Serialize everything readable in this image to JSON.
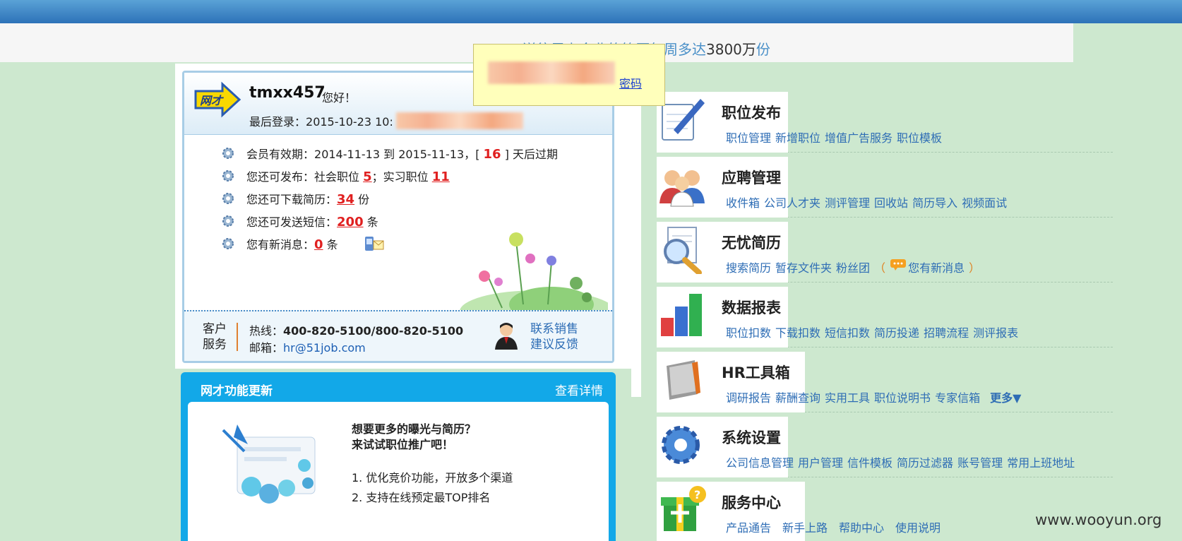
{
  "banner": {
    "text": "送往里上企业的简历每周多达",
    "number": "3800万",
    "unit": "份"
  },
  "tooltip": {
    "link": "密码"
  },
  "account": {
    "logo_text": "网才",
    "username": "tmxx457",
    "greeting": "您好！",
    "last_login_label": "最后登录：",
    "last_login_value": "2015-10-23 10:"
  },
  "stats": {
    "membership_label": "会员有效期：",
    "membership_start": "2014-11-13",
    "membership_to": "到",
    "membership_end": "2015-11-13，[",
    "membership_days": "16",
    "membership_suffix": "] 天后过期",
    "post_label": "您还可发布：社会职位",
    "post_social": "5",
    "post_sep": "；实习职位",
    "post_intern": "11",
    "download_label": "您还可下载简历：",
    "download_count": "34",
    "download_unit": "份",
    "sms_label": "您还可发送短信：",
    "sms_count": "200",
    "sms_unit": "条",
    "msg_label": "您有新消息：",
    "msg_count": "0",
    "msg_unit": "条"
  },
  "service": {
    "label": "客户服务",
    "hotline_label": "热线：",
    "hotline_value": "400-820-5100/800-820-5100",
    "email_label": "邮箱：",
    "email_value": "hr@51job.com",
    "sales_link": "联系销售",
    "feedback_link": "建议反馈"
  },
  "updates": {
    "title": "网才功能更新",
    "more": "查看详情",
    "headline1": "想要更多的曝光与简历？",
    "headline2": "来试试职位推广吧！",
    "item1": "1. 优化竞价功能，开放多个渠道",
    "item2": "2. 支持在线预定最TOP排名"
  },
  "menu": [
    {
      "title": "职位发布",
      "icon": "notepad-pen-icon",
      "links": [
        "职位管理",
        "新增职位",
        "增值广告服务",
        "职位模板"
      ]
    },
    {
      "title": "应聘管理",
      "icon": "people-group-icon",
      "links": [
        "收件箱",
        "公司人才夹",
        "测评管理",
        "回收站",
        "简历导入",
        "视频面试"
      ]
    },
    {
      "title": "无忧简历",
      "icon": "magnifier-document-icon",
      "links": [
        "搜索简历",
        "暂存文件夹",
        "粉丝团"
      ],
      "extra_open": "（",
      "extra": "您有新消息",
      "extra_close": "）"
    },
    {
      "title": "数据报表",
      "icon": "bar-chart-icon",
      "links": [
        "职位扣数",
        "下载扣数",
        "短信扣数",
        "简历投递",
        "招聘流程",
        "测评报表"
      ]
    },
    {
      "title": "HR工具箱",
      "icon": "toolbox-icon",
      "links": [
        "调研报告",
        "薪酬查询",
        "实用工具",
        "职位说明书",
        "专家信箱"
      ],
      "more": "更多▼"
    },
    {
      "title": "系统设置",
      "icon": "gear-icon",
      "links": [
        "公司信息管理",
        "用户管理",
        "信件模板",
        "简历过滤器",
        "账号管理",
        "常用上班地址"
      ]
    },
    {
      "title": "服务中心",
      "icon": "gift-box-icon",
      "links": [
        "产品通告",
        "新手上路",
        "帮助中心",
        "使用说明"
      ]
    }
  ],
  "watermark": "www.wooyun.org"
}
